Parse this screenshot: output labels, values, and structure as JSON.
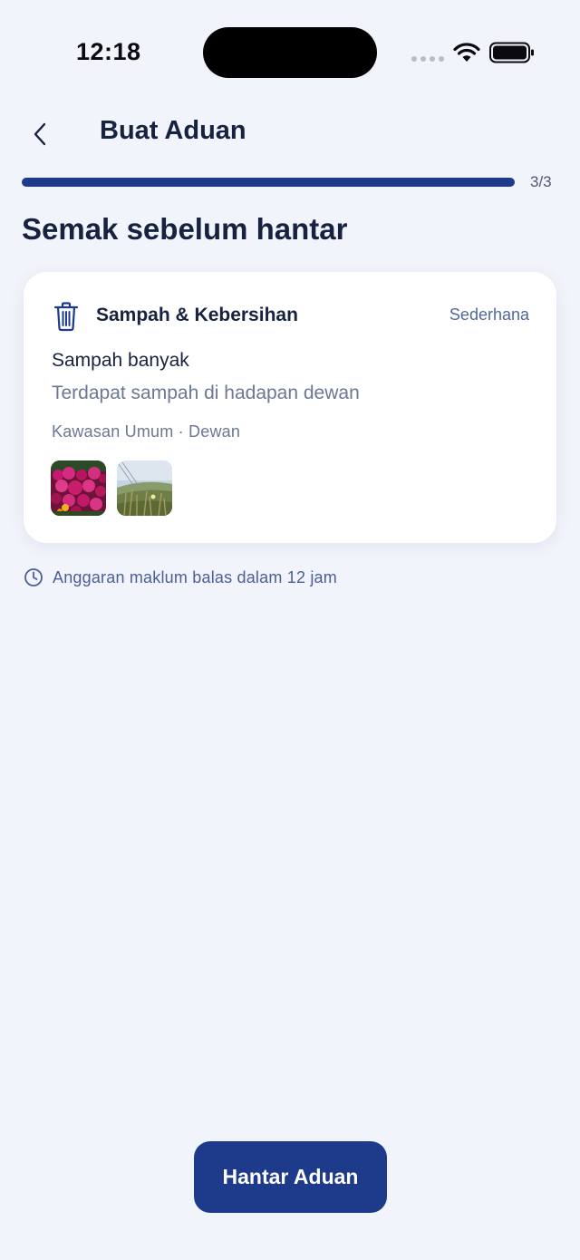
{
  "status_bar": {
    "time": "12:18"
  },
  "header": {
    "title": "Buat Aduan"
  },
  "progress": {
    "label": "3/3",
    "fraction": 1.0
  },
  "section_title": "Semak sebelum hantar",
  "summary": {
    "category": "Sampah & Kebersihan",
    "category_icon": "trash-icon",
    "severity": "Sederhana",
    "title": "Sampah banyak",
    "description": "Terdapat sampah di hadapan dewan",
    "location": "Kawasan Umum · Dewan",
    "photos": [
      "flowers-photo",
      "field-photo"
    ]
  },
  "eta": {
    "icon": "clock-icon",
    "text": "Anggaran maklum balas dalam 12 jam"
  },
  "submit_label": "Hantar Aduan",
  "colors": {
    "primary": "#1E3A8A",
    "background": "#F2F4FB",
    "muted_text": "#6B7794"
  }
}
